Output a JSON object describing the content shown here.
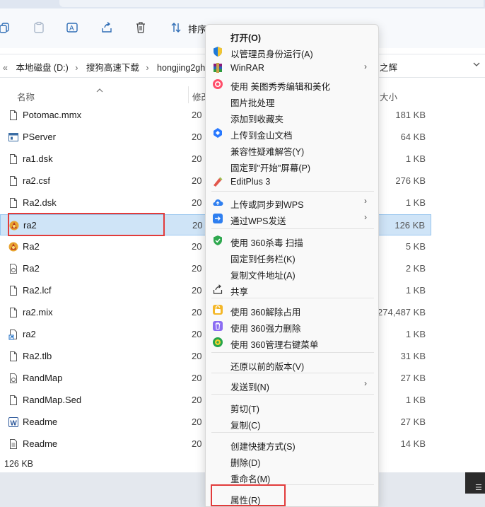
{
  "toolbar": {
    "sort_label": "排序"
  },
  "addressbar": {
    "crumbs": [
      "本地磁盘 (D:)",
      "搜狗高速下载",
      "hongjing2gh"
    ],
    "right_text": "之辉"
  },
  "columns": {
    "name": "名称",
    "modified": "修改",
    "size": "大小"
  },
  "files": [
    {
      "name": "Potomac.mmx",
      "date": "20",
      "size": "181 KB",
      "icon": "file-icon"
    },
    {
      "name": "PServer",
      "date": "20",
      "size": "64 KB",
      "icon": "app-window-icon"
    },
    {
      "name": "ra1.dsk",
      "date": "20",
      "size": "1 KB",
      "icon": "file-icon"
    },
    {
      "name": "ra2.csf",
      "date": "20",
      "size": "276 KB",
      "icon": "file-icon"
    },
    {
      "name": "Ra2.dsk",
      "date": "20",
      "size": "1 KB",
      "icon": "file-icon"
    },
    {
      "name": "ra2",
      "date": "20",
      "size": "126 KB",
      "icon": "ra2-game-icon"
    },
    {
      "name": "Ra2",
      "date": "20",
      "size": "5 KB",
      "icon": "ra2-game-icon"
    },
    {
      "name": "Ra2",
      "date": "20",
      "size": "2 KB",
      "icon": "settings-file-icon"
    },
    {
      "name": "Ra2.lcf",
      "date": "20",
      "size": "1 KB",
      "icon": "file-icon"
    },
    {
      "name": "ra2.mix",
      "date": "20",
      "size": "274,487 KB",
      "icon": "file-icon"
    },
    {
      "name": "ra2",
      "date": "20",
      "size": "1 KB",
      "icon": "shortcut-file-icon"
    },
    {
      "name": "Ra2.tlb",
      "date": "20",
      "size": "31 KB",
      "icon": "file-icon"
    },
    {
      "name": "RandMap",
      "date": "20",
      "size": "27 KB",
      "icon": "settings-file-icon"
    },
    {
      "name": "RandMap.Sed",
      "date": "20",
      "size": "1 KB",
      "icon": "file-icon"
    },
    {
      "name": "Readme",
      "date": "20",
      "size": "27 KB",
      "icon": "word-doc-icon"
    },
    {
      "name": "Readme",
      "date": "20",
      "size": "14 KB",
      "icon": "text-file-icon"
    }
  ],
  "status": {
    "selection_size": "126 KB"
  },
  "context_menu": {
    "items": [
      {
        "label": "打开(O)",
        "icon": "",
        "bold": true
      },
      {
        "label": "以管理员身份运行(A)",
        "icon": "uac-shield-icon"
      },
      {
        "label": "WinRAR",
        "icon": "winrar-icon",
        "submenu": true
      },
      {
        "label": "使用 美图秀秀编辑和美化",
        "icon": "meitu-icon"
      },
      {
        "label": "图片批处理",
        "icon": ""
      },
      {
        "label": "添加到收藏夹",
        "icon": ""
      },
      {
        "label": "上传到金山文档",
        "icon": "kdocs-icon"
      },
      {
        "label": "兼容性疑难解答(Y)",
        "icon": ""
      },
      {
        "label": "固定到\"开始\"屏幕(P)",
        "icon": ""
      },
      {
        "label": "EditPlus 3",
        "icon": "editplus-icon"
      },
      {
        "label": "上传或同步到WPS",
        "icon": "wps-cloud-icon",
        "submenu": true
      },
      {
        "label": "通过WPS发送",
        "icon": "wps-send-icon",
        "submenu": true
      },
      {
        "label": "使用 360杀毒 扫描",
        "icon": "shield-360-icon"
      },
      {
        "label": "固定到任务栏(K)",
        "icon": ""
      },
      {
        "label": "复制文件地址(A)",
        "icon": ""
      },
      {
        "label": "共享",
        "icon": "share-icon"
      },
      {
        "label": "使用 360解除占用",
        "icon": "unlock-360-icon"
      },
      {
        "label": "使用 360强力删除",
        "icon": "delete-360-icon"
      },
      {
        "label": "使用 360管理右键菜单",
        "icon": "menu-360-icon"
      },
      {
        "label": "还原以前的版本(V)",
        "icon": ""
      },
      {
        "label": "发送到(N)",
        "icon": "",
        "submenu": true
      },
      {
        "label": "剪切(T)",
        "icon": ""
      },
      {
        "label": "复制(C)",
        "icon": ""
      },
      {
        "label": "创建快捷方式(S)",
        "icon": ""
      },
      {
        "label": "删除(D)",
        "icon": ""
      },
      {
        "label": "重命名(M)",
        "icon": ""
      },
      {
        "label": "属性(R)",
        "icon": ""
      }
    ],
    "submenu_arrow": "›"
  },
  "colors": {
    "selection_bg": "#cfe4f7",
    "highlight_box": "#e23b3b",
    "accent_blue": "#0067c0"
  }
}
